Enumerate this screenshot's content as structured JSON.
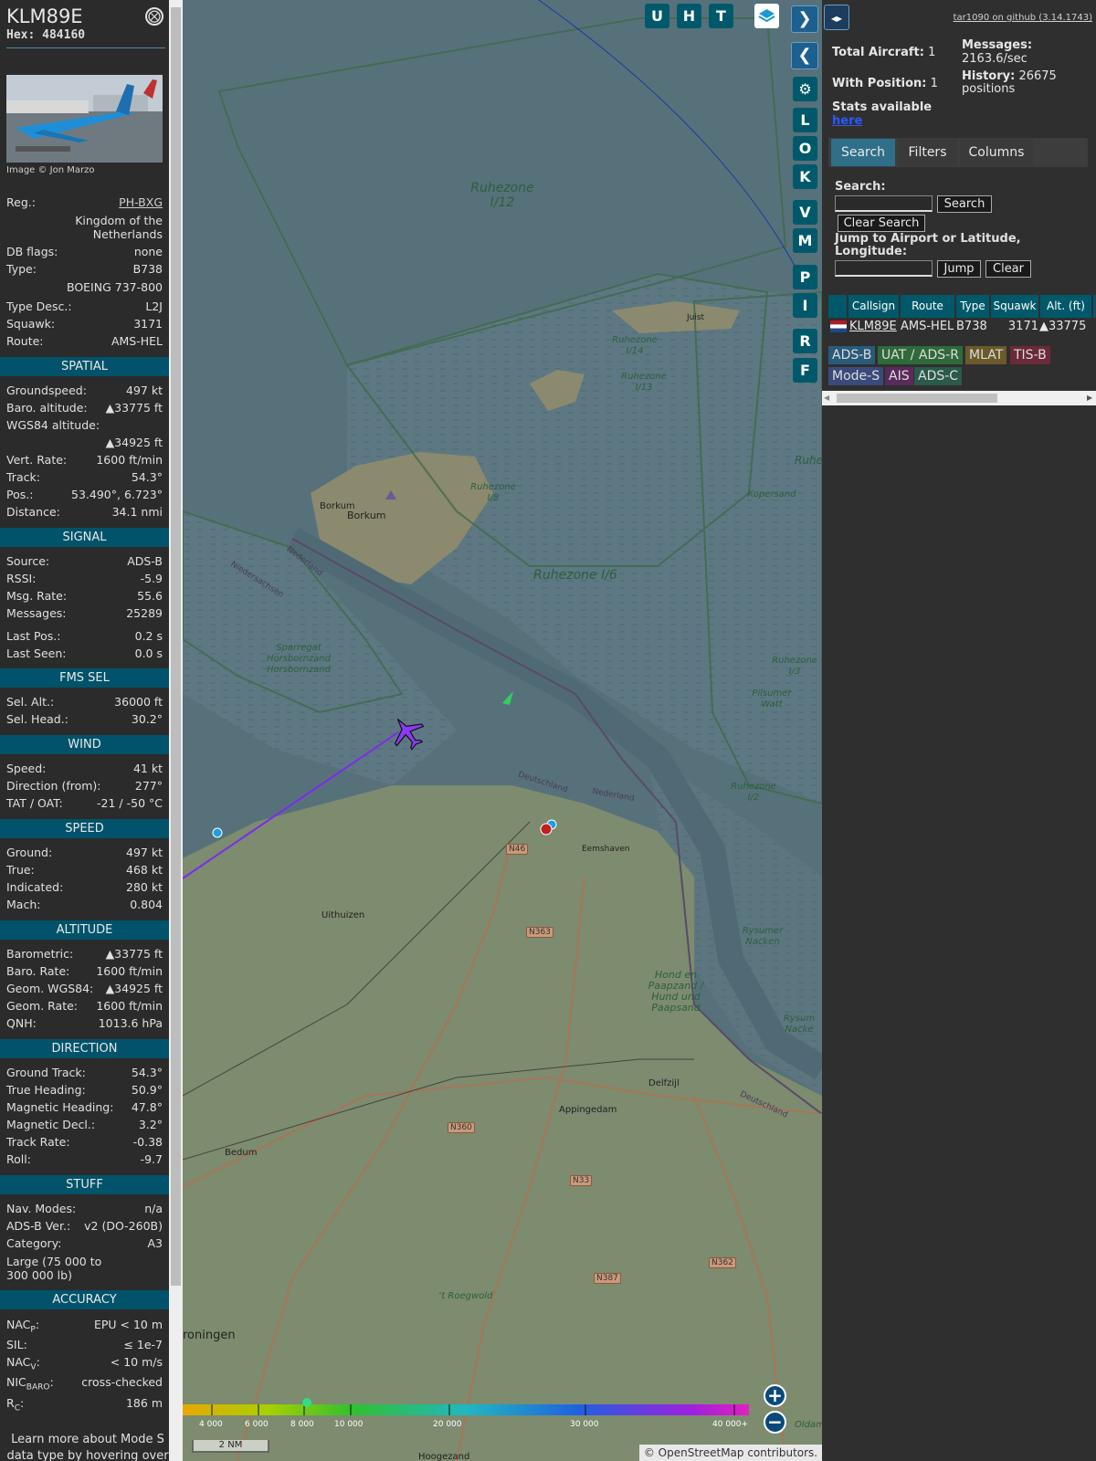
{
  "aircraft": {
    "callsign": "KLM89E",
    "hex_label": "Hex:",
    "hex": "484160",
    "photo_credit": "Image © Jon Marzo"
  },
  "close_label": "⨂",
  "info": {
    "reg_label": "Reg.:",
    "reg": "PH-BXG",
    "country": "Kingdom of the Netherlands",
    "dbflags_label": "DB flags:",
    "dbflags": "none",
    "type_label": "Type:",
    "type": "B738",
    "type_name": "BOEING 737-800",
    "typedesc_label": "Type Desc.:",
    "typedesc": "L2J",
    "squawk_label": "Squawk:",
    "squawk": "3171",
    "route_label": "Route:",
    "route": "AMS-HEL"
  },
  "spatial": {
    "header": "SPATIAL",
    "gs_label": "Groundspeed:",
    "gs": "497 kt",
    "baro_label": "Baro. altitude:",
    "baro": "▲33775 ft",
    "wgs_label": "WGS84 altitude:",
    "wgs": "▲34925 ft",
    "vrate_label": "Vert. Rate:",
    "vrate": "1600 ft/min",
    "track_label": "Track:",
    "track": "54.3°",
    "pos_label": "Pos.:",
    "pos": "53.490°, 6.723°",
    "dist_label": "Distance:",
    "dist": "34.1 nmi"
  },
  "signal": {
    "header": "SIGNAL",
    "src_label": "Source:",
    "src": "ADS-B",
    "rssi_label": "RSSI:",
    "rssi": "-5.9",
    "msgrate_label": "Msg. Rate:",
    "msgrate": "55.6",
    "msgs_label": "Messages:",
    "msgs": "25289",
    "lastpos_label": "Last Pos.:",
    "lastpos": "0.2 s",
    "lastseen_label": "Last Seen:",
    "lastseen": "0.0 s"
  },
  "fms": {
    "header": "FMS SEL",
    "alt_label": "Sel. Alt.:",
    "alt": "36000 ft",
    "head_label": "Sel. Head.:",
    "head": "30.2°"
  },
  "wind": {
    "header": "WIND",
    "speed_label": "Speed:",
    "speed": "41 kt",
    "dir_label": "Direction (from):",
    "dir": "277°",
    "tat_label": "TAT / OAT:",
    "tat": "-21 / -50 °C"
  },
  "speed": {
    "header": "SPEED",
    "ground_label": "Ground:",
    "ground": "497 kt",
    "true_label": "True:",
    "true": "468 kt",
    "ind_label": "Indicated:",
    "ind": "280 kt",
    "mach_label": "Mach:",
    "mach": "0.804"
  },
  "altitude": {
    "header": "ALTITUDE",
    "baro_label": "Barometric:",
    "baro": "▲33775 ft",
    "brate_label": "Baro. Rate:",
    "brate": "1600 ft/min",
    "geom_label": "Geom. WGS84:",
    "geom": "▲34925 ft",
    "grate_label": "Geom. Rate:",
    "grate": "1600 ft/min",
    "qnh_label": "QNH:",
    "qnh": "1013.6 hPa"
  },
  "direction": {
    "header": "DIRECTION",
    "gt_label": "Ground Track:",
    "gt": "54.3°",
    "th_label": "True Heading:",
    "th": "50.9°",
    "mh_label": "Magnetic Heading:",
    "mh": "47.8°",
    "md_label": "Magnetic Decl.:",
    "md": "3.2°",
    "tr_label": "Track Rate:",
    "tr": "-0.38",
    "roll_label": "Roll:",
    "roll": "-9.7"
  },
  "stuff": {
    "header": "STUFF",
    "nav_label": "Nav. Modes:",
    "nav": "n/a",
    "adsbver_label": "ADS-B Ver.:",
    "adsbver": "v2 (DO-260B)",
    "cat_label": "Category:",
    "cat": "A3",
    "cat_desc": "Large (75 000 to 300 000 lb)"
  },
  "accuracy": {
    "header": "ACCURACY",
    "nacp_label": "NAC",
    "nacp_sub": "P",
    "nacp": "EPU < 10 m",
    "sil_label": "SIL:",
    "sil": "≤ 1e-7",
    "nacv_label": "NAC",
    "nacv_sub": "V",
    "nacv": "< 10 m/s",
    "nicbaro_label": "NIC",
    "nicbaro_sub": "BARO",
    "nicbaro": "cross-checked",
    "rc_label": "R",
    "rc_sub": "C",
    "rc": "186 m"
  },
  "learn_more": "Learn more about Mode S data type by hovering over",
  "map": {
    "buttons": [
      "U",
      "H",
      "T"
    ],
    "side_buttons": [
      "L",
      "O",
      "K",
      "V",
      "M",
      "P",
      "I",
      "R",
      "F"
    ],
    "labels": {
      "borkum": "Borkum",
      "borkum2": "Borkum",
      "uithuizen": "Uithuizen",
      "eemshaven": "Eemshaven",
      "delfzijl": "Delfzijl",
      "appingedam": "Appingedam",
      "bedum": "Bedum",
      "groningen": "roningen",
      "hoogezand": "Hoogezand",
      "juist": "Juist",
      "nederland": "Nederland",
      "deutschland": "Deutschland",
      "nederland2": "Nederland",
      "niedersachsen": "Niedersachsen",
      "deutschland2": "Deutschland",
      "nederland3": "Nederland"
    },
    "zones": {
      "rz12": "Ruhezone I/12",
      "rz6": "Ruhezone I/6",
      "rz8": "Ruhezone I/8",
      "rz14": "Ruhezone I/14",
      "rz13": "Ruhezone I/13",
      "rz2": "Ruhezone I/2",
      "rz3": "Ruhezone I/3",
      "rzr": "Ruhe",
      "rzi": "I",
      "kopersand": "Kopersand",
      "pilsumer": "Pilsumer Watt",
      "sparregat": "Sparregat Horsbornzand Horsbornzand",
      "rysumer": "Rysumer Nacken",
      "hond": "Hond en Paapzand / Hund und Paapsand",
      "rysum2": "Rysum Nacke",
      "roegwold": "'t Roegwold",
      "oldam": "Oldam"
    },
    "roads": [
      "N46",
      "N363",
      "N360",
      "N33",
      "N387",
      "N362"
    ],
    "scale_ticks": [
      "4 000",
      "6 000",
      "8 000",
      "10 000",
      "20 000",
      "30 000",
      "40 000+"
    ],
    "scale_nm": "2 NM",
    "attribution": "© OpenStreetMap contributors.",
    "zoom_in": "+",
    "zoom_out": "−"
  },
  "right": {
    "github": "tar1090 on github (3.14.1743)",
    "total_label": "Total Aircraft:",
    "total": "1",
    "withpos_label": "With Position:",
    "withpos": "1",
    "stats_label": "Stats available",
    "stats_link": "here",
    "messages_label": "Messages:",
    "messages": "2163.6/sec",
    "history_label": "History:",
    "history": "26675 positions",
    "tabs": [
      "Search",
      "Filters",
      "Columns"
    ],
    "search_label": "Search:",
    "search_btn": "Search",
    "clear_search": "Clear Search",
    "jump_label": "Jump to Airport or Latitude, Longitude:",
    "jump_btn": "Jump",
    "clear_btn": "Clear",
    "table_headers": [
      "Callsign",
      "Route",
      "Type",
      "Squawk",
      "Alt. (ft)"
    ],
    "row": {
      "callsign": "KLM89E",
      "route": "AMS-HEL",
      "type": "B738",
      "squawk": "3171",
      "alt": "▲33775"
    },
    "sources": [
      "ADS-B",
      "UAT / ADS-R",
      "MLAT",
      "TIS-B",
      "Mode-S",
      "AIS",
      "ADS-C"
    ]
  },
  "colors": {
    "header": "#00536a",
    "accent": "#00596b",
    "track": "#7b2cf0"
  }
}
